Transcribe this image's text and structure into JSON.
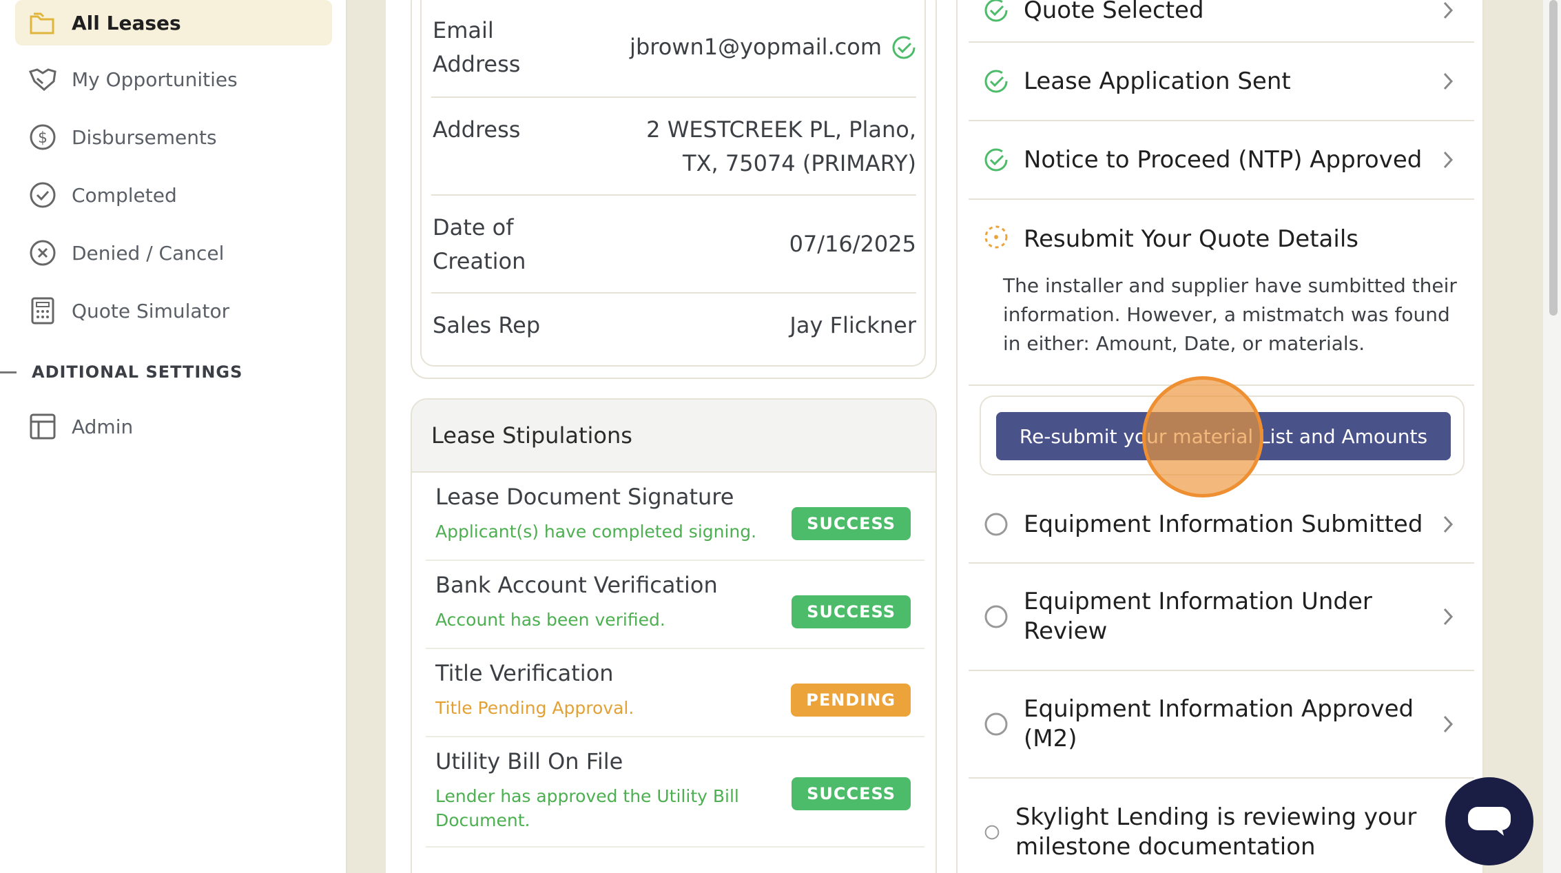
{
  "sidebar": {
    "items": [
      {
        "label": "All Leases",
        "icon": "folder-icon",
        "active": true
      },
      {
        "label": "My Opportunities",
        "icon": "handshake-icon"
      },
      {
        "label": "Disbursements",
        "icon": "dollar-circle-icon"
      },
      {
        "label": "Completed",
        "icon": "check-circle-icon"
      },
      {
        "label": "Denied / Cancel",
        "icon": "x-circle-icon"
      },
      {
        "label": "Quote Simulator",
        "icon": "calculator-icon"
      }
    ],
    "section_title": "ADITIONAL SETTINGS",
    "admin_label": "Admin"
  },
  "details": {
    "email_key_1": "Email",
    "email_key_2": "Address",
    "email_value": "jbrown1@yopmail.com",
    "address_key": "Address",
    "address_value_1": "2 WESTCREEK PL, Plano,",
    "address_value_2": "TX, 75074 (PRIMARY)",
    "date_key_1": "Date of",
    "date_key_2": "Creation",
    "date_value": "07/16/2025",
    "rep_key": "Sales Rep",
    "rep_value": "Jay Flickner"
  },
  "stipulations": {
    "title": "Lease Stipulations",
    "rows": [
      {
        "title": "Lease Document Signature",
        "sub": "Applicant(s) have completed signing.",
        "status": "SUCCESS"
      },
      {
        "title": "Bank Account Verification",
        "sub": "Account has been verified.",
        "status": "SUCCESS"
      },
      {
        "title": "Title Verification",
        "sub": "Title Pending Approval.",
        "status": "PENDING"
      },
      {
        "title": "Utility Bill On File",
        "sub": "Lender has approved the Utility Bill Document.",
        "status": "SUCCESS"
      }
    ]
  },
  "steps": {
    "quote_selected": "Quote Selected",
    "lease_app_sent": "Lease Application Sent",
    "ntp_approved": "Notice to Proceed (NTP) Approved",
    "resubmit_title": "Resubmit Your Quote Details",
    "resubmit_desc": "The installer and supplier have sumbitted their information. However, a mistmatch was found in either: Amount, Date, or materials.",
    "resubmit_button": "Re-submit your material List and Amounts",
    "equip_submitted": "Equipment Information Submitted",
    "equip_review": "Equipment Information Under Review",
    "equip_approved": "Equipment Information Approved (M2)",
    "skylight_review": "Skylight Lending is reviewing your milestone documentation"
  },
  "colors": {
    "accent_green": "#4cbb6a",
    "pending_orange": "#eca43a",
    "button_navy": "#4a528a",
    "chat_navy": "#1a1e45"
  }
}
